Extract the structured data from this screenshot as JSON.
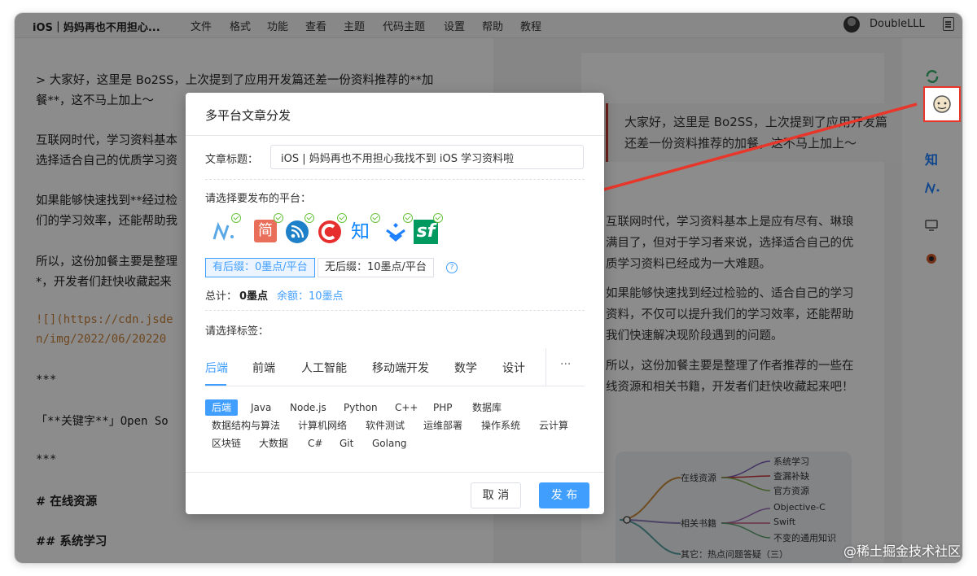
{
  "menubar": {
    "doc_title": "iOS｜妈妈再也不用担心...",
    "items": [
      "文件",
      "格式",
      "功能",
      "查看",
      "主题",
      "代码主题",
      "设置",
      "帮助",
      "教程"
    ],
    "username": "DoubleLLL"
  },
  "editor": {
    "lines": [
      "> 大家好，这里是 Bo2SS，上次提到了应用开发篇还差一份资料推荐的**加",
      "餐**，这不马上加上～",
      "互联网时代，学习资料基本",
      "选择适合自己的优质学习资",
      "如果能够快速找到**经过检",
      "们的学习效率，还能帮助我",
      "所以，这份加餐主要是整理",
      "*，开发者们赶快收藏起来",
      "![](https://cdn.jsde",
      "n/img/2022/06/20220",
      "***",
      "「**关键字**」Open So",
      "***",
      "#  在线资源",
      "##  系统学习"
    ]
  },
  "preview": {
    "quote": "大家好，这里是 Bo2SS，上次提到了应用开发篇还差一份资料推荐的加餐，这不马上加上～",
    "p1": "互联网时代，学习资料基本上是应有尽有、琳琅满目了，但对于学习者来说，选择适合自己的优质学习资料已经成为一大难题。",
    "p2": "如果能够快速找到经过检验的、适合自己的学习资料，不仅可以提升我们的学习效率，还能帮助我们快速解决现阶段遇到的问题。",
    "p3": "所以，这份加餐主要是整理了作者推荐的一些在线资源和相关书籍，开发者们赶快收藏起来吧！",
    "mindmap": {
      "branch1": "在线资源",
      "leaves1": [
        "系统学习",
        "查漏补缺",
        "官方资源"
      ],
      "branch2": "相关书籍",
      "leaves2": [
        "Objective-C",
        "Swift",
        "不变的通用知识"
      ],
      "branch3": "其它：热点问题答疑（三）"
    }
  },
  "side_icons": {
    "zhihu": "知"
  },
  "dialog": {
    "title": "多平台文章分发",
    "article_title_label": "文章标题：",
    "article_title_value": "iOS | 妈妈再也不用担心我找不到 iOS 学习资料啦",
    "platform_label": "请选择要发布的平台：",
    "platforms": [
      "mdnice-icon",
      "jianshu-icon",
      "rss-icon",
      "csdn-icon",
      "zhihu-icon",
      "juejin-icon",
      "segmentfault-icon"
    ],
    "platform_zhihu_text": "知",
    "platform_jianshu_text": "简",
    "platform_sf_text": "sf",
    "suffix_with": "有后缀：0墨点/平台",
    "suffix_without": "无后缀：10墨点/平台",
    "total_label": "总计：",
    "total_value": "0墨点",
    "balance": "余额：10墨点",
    "tag_label": "请选择标签：",
    "tabs": [
      "后端",
      "前端",
      "人工智能",
      "移动端开发",
      "数学",
      "设计"
    ],
    "tabs_more": "···",
    "tags": [
      "后端",
      "Java",
      "Node.js",
      "Python",
      "C++",
      "PHP",
      "数据库",
      "数据结构与算法",
      "计算机网络",
      "软件测试",
      "运维部署",
      "操作系统",
      "云计算",
      "区块链",
      "大数据",
      "C#",
      "Git",
      "Golang"
    ],
    "cancel": "取 消",
    "publish": "发 布"
  },
  "watermark": "@稀土掘金技术社区",
  "colors": {
    "accent": "#409eff",
    "annotation": "#e8372a",
    "check": "#67c23a"
  }
}
